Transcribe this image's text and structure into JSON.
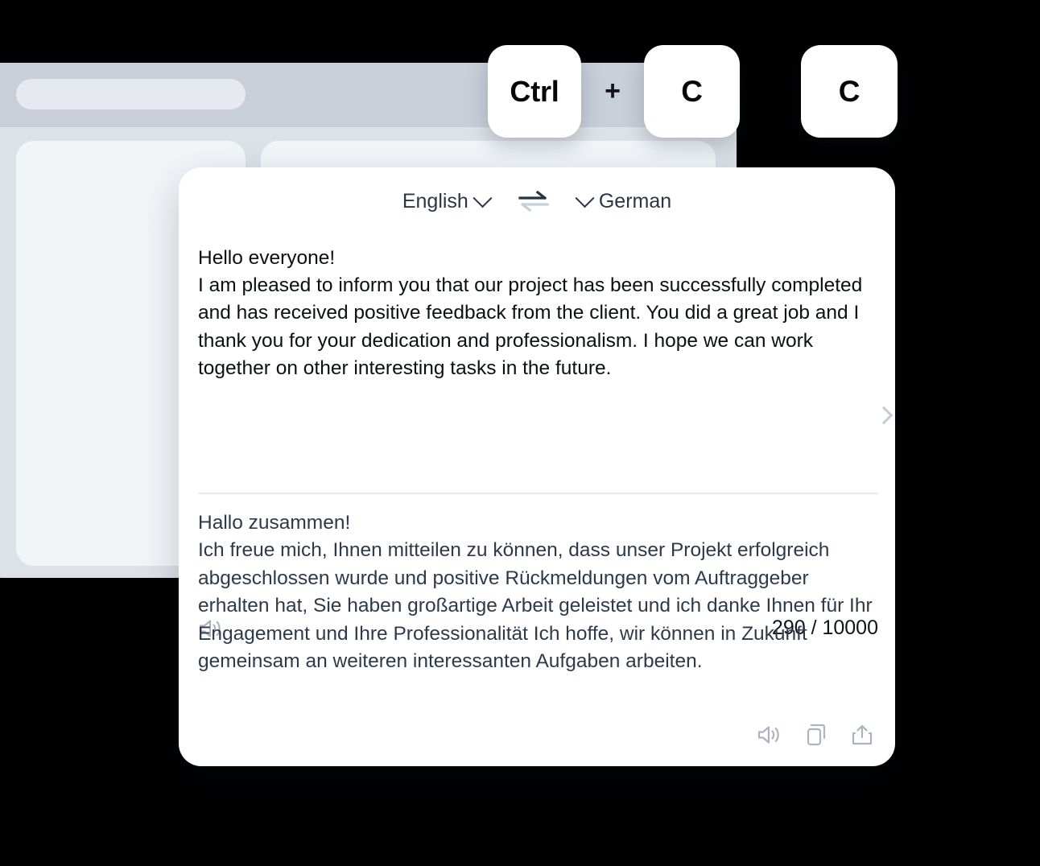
{
  "background_window": {
    "search_pill": "",
    "panels": [
      "left-panel",
      "right-panel"
    ]
  },
  "shortcut": {
    "keys": [
      {
        "name": "key-ctrl",
        "label": "Ctrl"
      },
      {
        "name": "key-plus",
        "label": "+"
      },
      {
        "name": "key-c1",
        "label": "C"
      }
    ],
    "standalone_key": {
      "name": "key-c2",
      "label": "C"
    }
  },
  "translator": {
    "source_language": "English",
    "target_language": "German",
    "swap_icon": "swap-arrows-icon",
    "source_dropdown_icon": "chevron-down-icon",
    "target_dropdown_icon": "chevron-down-icon",
    "source_text": "Hello everyone!\nI am pleased to inform you that our project has been successfully completed and has received positive feedback from the client. You did a great job and I thank you for your dedication and professionalism. I hope we can work together on other interesting tasks in the future.",
    "target_text": "Hallo zusammen!\nIch freue mich, Ihnen mitteilen zu können, dass unser Projekt erfolgreich abgeschlossen wurde und positive Rückmeldungen vom Auftraggeber erhalten hat, Sie haben großartige Arbeit geleistet und ich danke Ihnen für Ihr Engagement und Ihre Professionalität Ich hoffe, wir können in Zukunft gemeinsam an weiteren interessanten Aufgaben arbeiten.",
    "char_count": "290 / 10000",
    "source_speaker_icon": "speaker-icon",
    "actions": [
      {
        "name": "speak-translation-button",
        "icon": "speaker-icon"
      },
      {
        "name": "copy-translation-button",
        "icon": "copy-icon"
      },
      {
        "name": "share-translation-button",
        "icon": "share-icon"
      }
    ],
    "next_icon": "chevron-right-icon"
  },
  "colors": {
    "card_background": "#ffffff",
    "page_background": "#000000",
    "window_titlebar": "#c9cfd9",
    "window_body": "#dde1e8",
    "panel": "#f1f5f8",
    "source_text": "#0c0f14",
    "target_text": "#2c3a4c",
    "icon_gray": "#aab4c0",
    "swap_dark": "#243447",
    "swap_light": "#c3d0de"
  }
}
